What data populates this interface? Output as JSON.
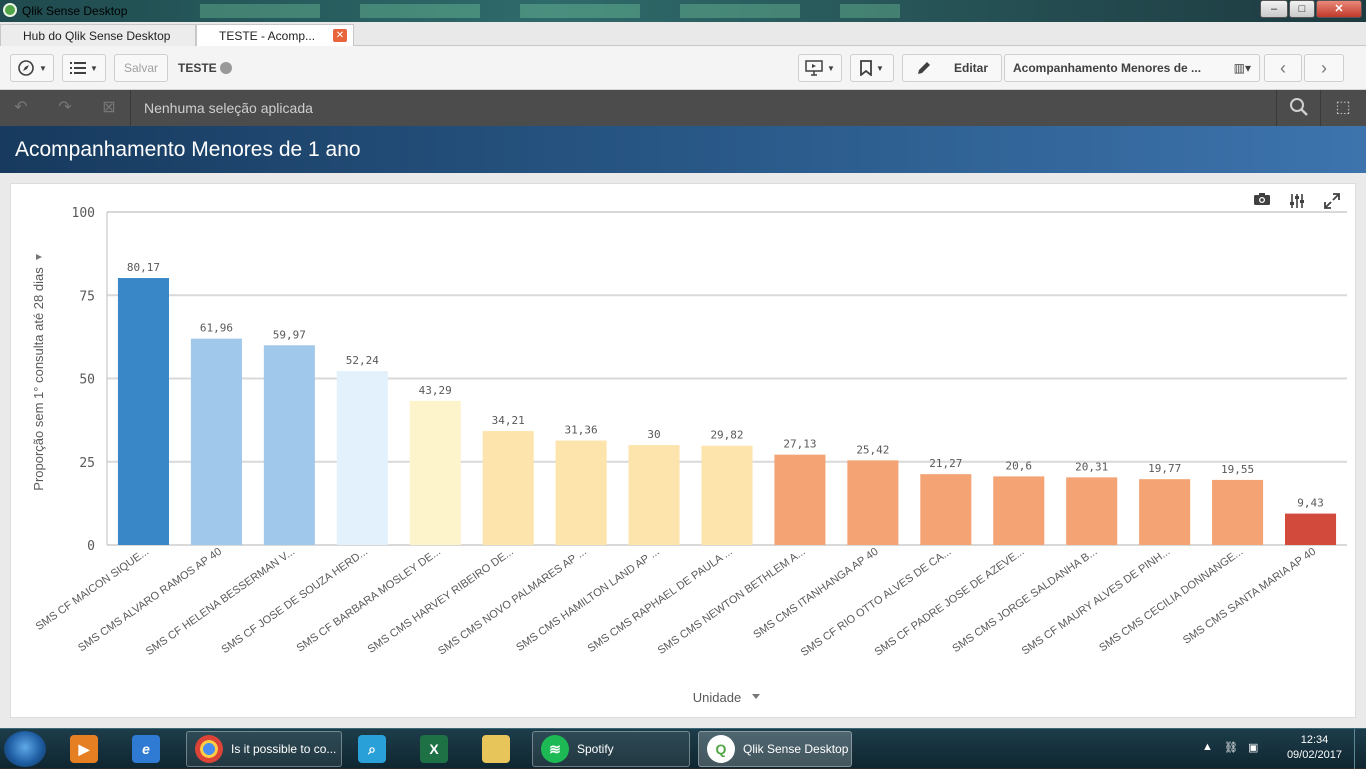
{
  "window": {
    "title": "Qlik Sense Desktop",
    "buttons": {
      "minimize": "–",
      "maximize": "□",
      "close": "✕"
    }
  },
  "tabs": [
    {
      "label": "Hub do Qlik Sense Desktop",
      "active": false
    },
    {
      "label": "TESTE - Acomp...",
      "active": true,
      "close": "✕"
    }
  ],
  "toolbar": {
    "save_label": "Salvar",
    "app_name": "TESTE",
    "edit_label": "Editar",
    "sheet_selector": "Acompanhamento Menores de ..."
  },
  "selections": {
    "text": "Nenhuma seleção aplicada"
  },
  "sheet": {
    "title": "Acompanhamento Menores de 1 ano"
  },
  "chart_data": {
    "type": "bar",
    "title": "",
    "ylabel": "Proporção sem 1° consulta até 28 dias",
    "xlabel": "Unidade",
    "ylim": [
      0,
      100
    ],
    "yticks": [
      "0",
      "25",
      "50",
      "75",
      "100"
    ],
    "grid": true,
    "categories": [
      "SMS CF MAICON SIQUE...",
      "SMS CMS ALVARO RAMOS AP 40",
      "SMS CF HELENA BESSERMAN V...",
      "SMS CF JOSE DE SOUZA HERD...",
      "SMS CF BARBARA MOSLEY DE...",
      "SMS CMS HARVEY RIBEIRO DE...",
      "SMS CMS NOVO PALMARES AP ...",
      "SMS CMS HAMILTON LAND AP ...",
      "SMS CMS RAPHAEL DE PAULA ...",
      "SMS CMS NEWTON BETHLEM A...",
      "SMS CMS ITANHANGA AP 40",
      "SMS CF RIO OTTO ALVES DE CA...",
      "SMS CF PADRE JOSE DE AZEVE...",
      "SMS CMS JORGE SALDANHA B...",
      "SMS CF MAURY ALVES DE PINH...",
      "SMS CMS CECILIA DONNANGE...",
      "SMS CMS SANTA MARIA AP 40"
    ],
    "values": [
      80.17,
      61.96,
      59.97,
      52.24,
      43.29,
      34.21,
      31.36,
      30,
      29.82,
      27.13,
      25.42,
      21.27,
      20.6,
      20.31,
      19.77,
      19.55,
      9.43
    ],
    "labels": [
      "80,17",
      "61,96",
      "59,97",
      "52,24",
      "43,29",
      "34,21",
      "31,36",
      "30",
      "29,82",
      "27,13",
      "25,42",
      "21,27",
      "20,6",
      "20,31",
      "19,77",
      "19,55",
      "9,43"
    ],
    "colors": [
      "#3a87c8",
      "#9fc8ea",
      "#9fc8ea",
      "#e3f1fc",
      "#fdf4cc",
      "#fde3ac",
      "#fde3ac",
      "#fde3ac",
      "#fde3ac",
      "#f4a474",
      "#f4a474",
      "#f4a474",
      "#f4a474",
      "#f4a474",
      "#f4a474",
      "#f4a474",
      "#d24a3b"
    ]
  },
  "taskbar": {
    "items": [
      {
        "label": "Is it possible to co...",
        "icon": "chrome-icon"
      },
      {
        "label": "Spotify",
        "icon": "spotify-icon"
      },
      {
        "label": "Qlik Sense Desktop",
        "icon": "qlik-icon"
      }
    ],
    "time": "12:34",
    "date": "09/02/2017"
  }
}
